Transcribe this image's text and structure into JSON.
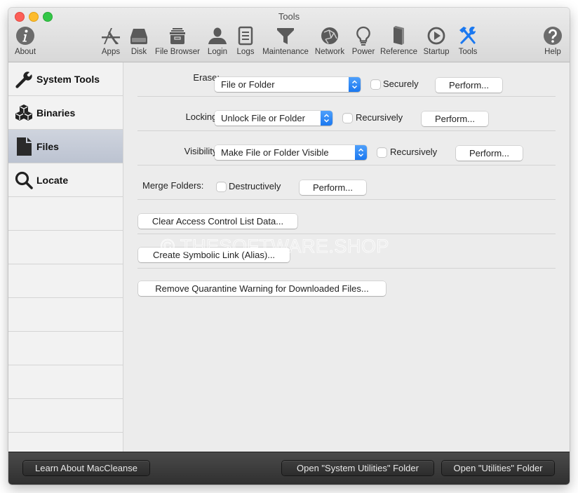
{
  "window": {
    "title": "Tools"
  },
  "toolbar": {
    "items": [
      {
        "label": "About",
        "icon": "info-icon"
      },
      {
        "label": "Apps",
        "icon": "apps-icon"
      },
      {
        "label": "Disk",
        "icon": "disk-icon"
      },
      {
        "label": "File Browser",
        "icon": "file-cabinet-icon"
      },
      {
        "label": "Login",
        "icon": "user-icon"
      },
      {
        "label": "Logs",
        "icon": "document-list-icon"
      },
      {
        "label": "Maintenance",
        "icon": "funnel-icon"
      },
      {
        "label": "Network",
        "icon": "globe-network-icon"
      },
      {
        "label": "Power",
        "icon": "lightbulb-icon"
      },
      {
        "label": "Reference",
        "icon": "book-icon"
      },
      {
        "label": "Startup",
        "icon": "play-circle-icon"
      },
      {
        "label": "Tools",
        "icon": "hammer-wrench-icon",
        "active": true
      },
      {
        "label": "Help",
        "icon": "question-icon"
      }
    ],
    "accent_color": "#1a78f0"
  },
  "sidebar": {
    "items": [
      {
        "label": "System Tools",
        "icon": "wrench-icon"
      },
      {
        "label": "Binaries",
        "icon": "cubes-icon"
      },
      {
        "label": "Files",
        "icon": "file-icon",
        "selected": true
      },
      {
        "label": "Locate",
        "icon": "magnifier-icon"
      }
    ]
  },
  "content": {
    "erase": {
      "label": "Erase:",
      "popup_value": "File or Folder",
      "checkbox_label": "Securely",
      "checkbox_checked": false,
      "button": "Perform..."
    },
    "locking": {
      "label": "Locking:",
      "popup_value": "Unlock File or Folder",
      "checkbox_label": "Recursively",
      "checkbox_checked": false,
      "button": "Perform..."
    },
    "visibility": {
      "label": "Visibility:",
      "popup_value": "Make File or Folder Visible",
      "checkbox_label": "Recursively",
      "checkbox_checked": false,
      "button": "Perform..."
    },
    "merge": {
      "label": "Merge Folders:",
      "checkbox_label": "Destructively",
      "checkbox_checked": false,
      "button": "Perform..."
    },
    "clear_acl_button": "Clear Access Control List Data...",
    "symlink_button": "Create Symbolic Link (Alias)...",
    "quarantine_button": "Remove Quarantine Warning for Downloaded Files...",
    "watermark": "© THESOFTWARE.SHOP"
  },
  "footer": {
    "learn_button": "Learn About MacCleanse",
    "system_utilities_button": "Open \"System Utilities\" Folder",
    "utilities_button": "Open \"Utilities\" Folder"
  }
}
